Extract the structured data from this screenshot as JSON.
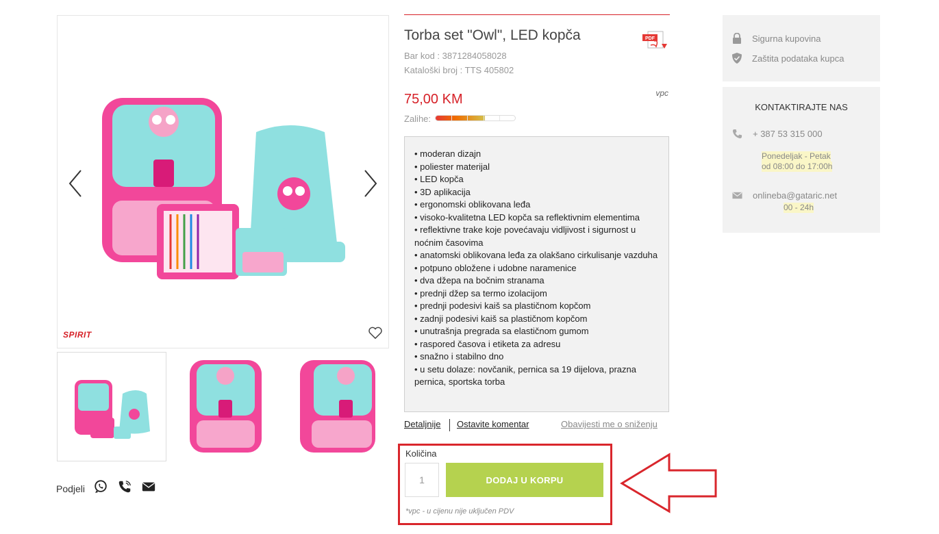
{
  "product": {
    "title": "Torba set \"Owl\", LED kopča",
    "barcode": "Bar kod : 3871284058028",
    "catalog": "Kataloški broj : TTS 405802",
    "price": "75,00 KM",
    "vpc": "vpc",
    "stock_label": "Zalihe:",
    "stock_level_fraction": 0.62,
    "brand": "SPIRIT",
    "features": [
      "moderan dizajn",
      "poliester materijal",
      "LED kopča",
      "3D aplikacija",
      "ergonomski oblikovana leđa",
      "visoko-kvalitetna LED kopča sa reflektivnim elementima",
      "reflektivne trake koje povećavaju vidljivost i sigurnost u noćnim časovima",
      "anatomski oblikovana leđa za olakšano cirkulisanje vazduha",
      "potpuno obložene i udobne naramenice",
      "dva džepa na bočnim stranama",
      "prednji džep sa termo izolacijom",
      "prednji podesivi kaiš sa plastičnom kopčom",
      "zadnji podesivi kaiš sa plastičnom kopčom",
      "unutrašnja pregrada sa elastičnom gumom",
      "raspored časova i etiketa za adresu",
      "snažno i stabilno dno",
      "u setu dolaze: novčanik, pernica sa 19 dijelova, prazna pernica, sportska torba"
    ]
  },
  "links": {
    "details": "Detaljnije",
    "comment": "Ostavite komentar",
    "notify": "Obavijesti me o sniženju"
  },
  "cart": {
    "qty_label": "Količina",
    "qty_value": "1",
    "button": "DODAJ U KORPU",
    "note": "*vpc - u cijenu nije uključen PDV"
  },
  "share": {
    "label": "Podjeli"
  },
  "sidebar": {
    "secure": "Sigurna kupovina",
    "privacy": "Zaštita podataka kupca",
    "contact_title": "KONTAKTIRAJTE NAS",
    "phone": "+ 387 53 315 000",
    "hours_days": "Ponedeljak - Petak",
    "hours_time": "od 08:00 do 17:00h",
    "email": "onlineba@gataric.net",
    "email_hours": "00 - 24h"
  },
  "colors": {
    "accent": "#d62027",
    "cart_button": "#b5d24f",
    "highlight_box": "#d9262c"
  }
}
